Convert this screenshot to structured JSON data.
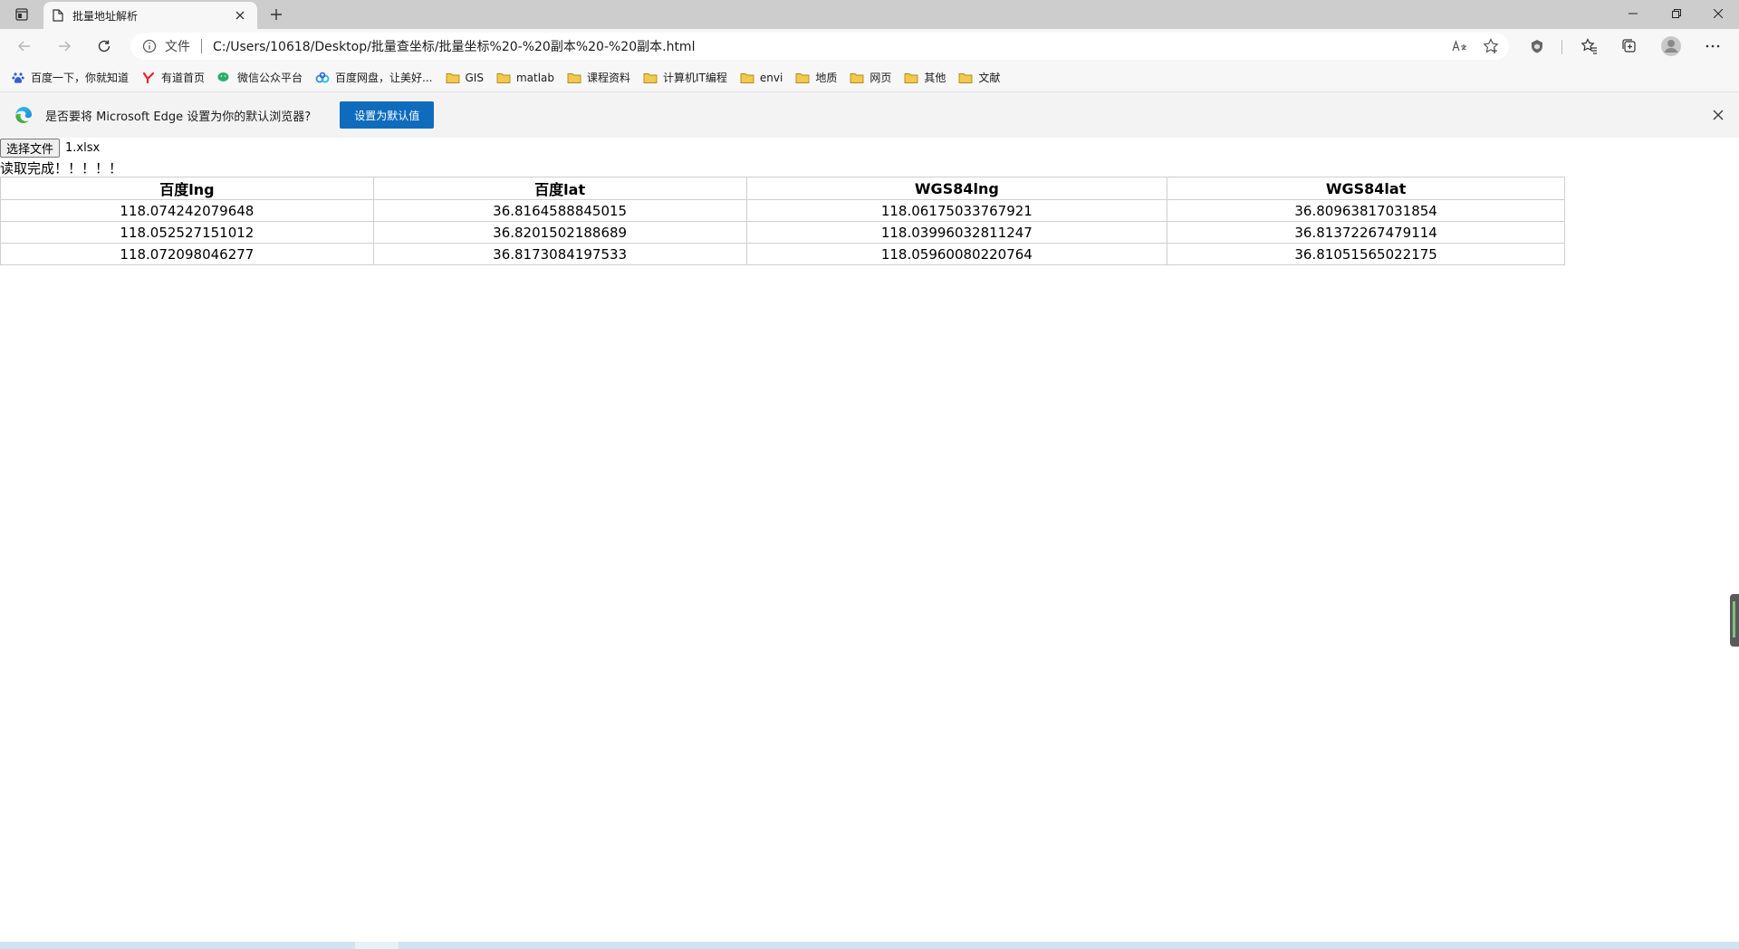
{
  "browser": {
    "tab": {
      "title": "批量地址解析"
    },
    "address": {
      "scheme_label": "文件",
      "url": "C:/Users/10618/Desktop/批量查坐标/批量坐标%20-%20副本%20-%20副本.html"
    },
    "bookmarks": [
      {
        "label": "百度一下，你就知道",
        "icon": "baidu-paw-icon"
      },
      {
        "label": "有道首页",
        "icon": "youdao-icon"
      },
      {
        "label": "微信公众平台",
        "icon": "wechat-icon"
      },
      {
        "label": "百度网盘，让美好...",
        "icon": "baidu-netdisk-icon"
      },
      {
        "label": "GIS",
        "icon": "folder-icon"
      },
      {
        "label": "matlab",
        "icon": "folder-icon"
      },
      {
        "label": "课程资料",
        "icon": "folder-icon"
      },
      {
        "label": "计算机IT编程",
        "icon": "folder-icon"
      },
      {
        "label": "envi",
        "icon": "folder-icon"
      },
      {
        "label": "地质",
        "icon": "folder-icon"
      },
      {
        "label": "网页",
        "icon": "folder-icon"
      },
      {
        "label": "其他",
        "icon": "folder-icon"
      },
      {
        "label": "文献",
        "icon": "folder-icon"
      }
    ],
    "infobar": {
      "message": "是否要将 Microsoft Edge 设置为你的默认浏览器?",
      "button_label": "设置为默认值"
    }
  },
  "page": {
    "file_button_label": "选择文件",
    "file_name": "1.xlsx",
    "status_text": "读取完成！！！！！",
    "table": {
      "headers": [
        "百度lng",
        "百度lat",
        "WGS84lng",
        "WGS84lat"
      ],
      "rows": [
        [
          "118.074242079648",
          "36.8164588845015",
          "118.06175033767921",
          "36.80963817031854"
        ],
        [
          "118.052527151012",
          "36.8201502188689",
          "118.03996032811247",
          "36.81372267479114"
        ],
        [
          "118.072098046277",
          "36.8173084197533",
          "118.05960080220764",
          "36.81051565022175"
        ]
      ]
    }
  },
  "colors": {
    "accent": "#0f6cbd",
    "folder": "#f2c94c",
    "wechat": "#2aae67"
  }
}
